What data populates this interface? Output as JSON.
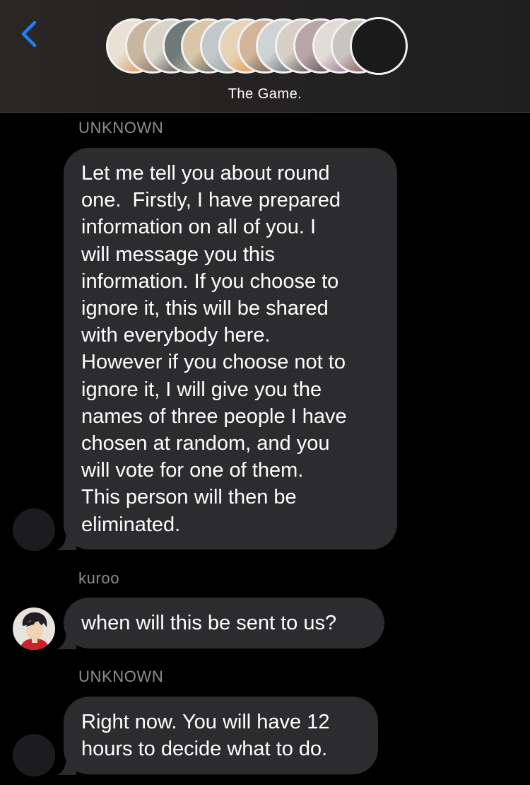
{
  "header": {
    "back_icon": "chevron-left-icon",
    "group_name": "The Game.",
    "accent_color": "#1a82fb",
    "avatars": [
      {
        "colors": [
          "#e9e2d4",
          "#d97b2e"
        ]
      },
      {
        "colors": [
          "#c8b6a3",
          "#7a5b48"
        ]
      },
      {
        "colors": [
          "#d9d4c9",
          "#2a2a2a"
        ]
      },
      {
        "colors": [
          "#6f7a78",
          "#c9c5bd"
        ]
      },
      {
        "colors": [
          "#d9c6a8",
          "#3a3a3a"
        ]
      },
      {
        "colors": [
          "#c2c7c9",
          "#8a8f93"
        ]
      },
      {
        "colors": [
          "#e8d2b6",
          "#e08a2a"
        ]
      },
      {
        "colors": [
          "#d2b59a",
          "#4a3b33"
        ]
      },
      {
        "colors": [
          "#cfd3d6",
          "#3c4a5a"
        ]
      },
      {
        "colors": [
          "#d7cfc5",
          "#27292f"
        ]
      },
      {
        "colors": [
          "#b9a4a8",
          "#3d3440"
        ]
      },
      {
        "colors": [
          "#e1ddd6",
          "#7a4a7e"
        ]
      },
      {
        "colors": [
          "#c8c5bf",
          "#7a2a2a"
        ]
      },
      {
        "colors": [
          "#1a1a1a",
          "#1a1a1a"
        ]
      }
    ]
  },
  "messages": [
    {
      "sender": "UNKNOWN",
      "lines": [
        "Let me tell you about round",
        "one.  Firstly, I have prepared",
        "information on all of you. I",
        "will message you this",
        "information. If you choose to",
        "ignore it, this will be shared",
        "with everybody here.",
        "However if you choose not to",
        "ignore it, I will give you the",
        "names of three people I have",
        "chosen at random, and you",
        "will vote for one of them.",
        "This person will then be",
        "eliminated."
      ],
      "avatar": "blank-avatar"
    },
    {
      "sender": "kuroo",
      "lines": [
        "when will this be sent to us?"
      ],
      "avatar": "kuroo-avatar"
    },
    {
      "sender": "UNKNOWN",
      "lines": [
        "Right now. You will have 12",
        "hours to decide what to do."
      ],
      "avatar": "blank-avatar"
    }
  ],
  "colors": {
    "background": "#000000",
    "bubble": "#2c2c2e",
    "sender_label": "#8e8e93"
  }
}
